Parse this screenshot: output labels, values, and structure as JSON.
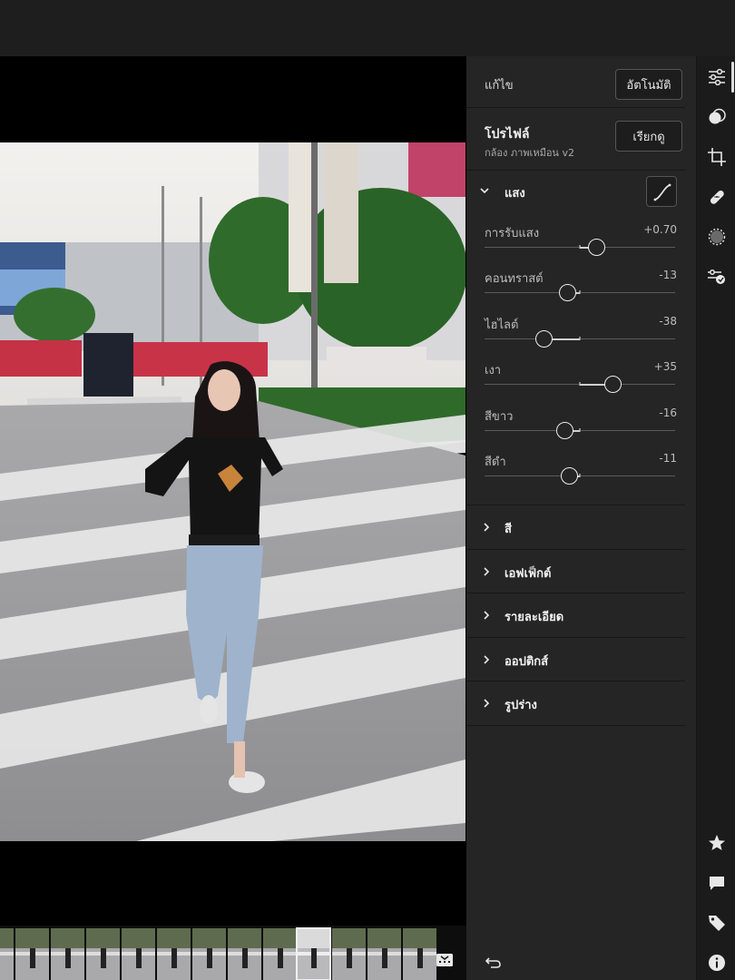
{
  "header": {
    "title": "แก้ไข",
    "auto_label": "อัตโนมัติ"
  },
  "profile": {
    "label": "โปรไฟล์",
    "name": "กล้อง ภาพเหมือน v2",
    "browse_label": "เรียกดู"
  },
  "light": {
    "label": "แสง",
    "sliders": [
      {
        "label": "การรับแสง",
        "value_text": "+0.70",
        "level": 0.59
      },
      {
        "label": "คอนทราสต์",
        "value_text": "-13",
        "level": 0.435
      },
      {
        "label": "ไฮไลต์",
        "value_text": "-38",
        "level": 0.31
      },
      {
        "label": "เงา",
        "value_text": "+35",
        "level": 0.675
      },
      {
        "label": "สีขาว",
        "value_text": "-16",
        "level": 0.42
      },
      {
        "label": "สีดำ",
        "value_text": "-11",
        "level": 0.445
      }
    ]
  },
  "sections": [
    {
      "label": "สี"
    },
    {
      "label": "เอฟเฟ็กต์"
    },
    {
      "label": "รายละเอียด"
    },
    {
      "label": "ออปติกส์"
    },
    {
      "label": "รูปร่าง"
    }
  ],
  "rail_icons": [
    "sliders-icon",
    "color-mix-icon",
    "crop-icon",
    "healing-icon",
    "mask-icon",
    "presets-icon",
    "star-icon",
    "comment-icon",
    "tag-icon",
    "info-icon"
  ],
  "filmstrip": {
    "count": 13,
    "active": 8
  },
  "colors": {
    "panel": "#252525",
    "rail": "#1b1b1b",
    "accent": "#ececec"
  }
}
